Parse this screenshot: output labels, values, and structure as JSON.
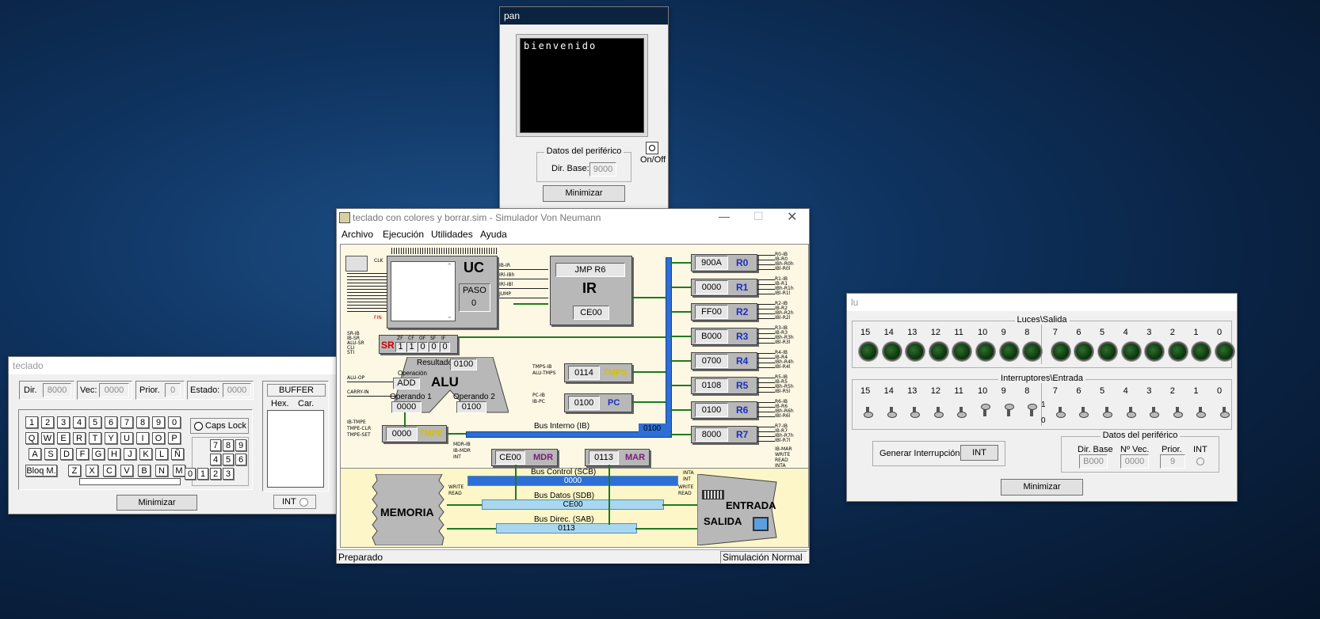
{
  "pan": {
    "title": "pan",
    "screen_text": "bienvenido",
    "group_title": "Datos del periférico",
    "dir_base_label": "Dir. Base:",
    "dir_base_value": "9000",
    "onoff_label": "On/Off",
    "minimize_label": "Minimizar"
  },
  "main": {
    "title": "teclado con colores y borrar.sim - Simulador Von Neumann",
    "menu": [
      "Archivo",
      "Ejecución",
      "Utilidades",
      "Ayuda"
    ],
    "status_left": "Preparado",
    "status_right": "Simulación Normal",
    "uc": {
      "label": "UC",
      "paso_label": "PASO",
      "paso_value": "0"
    },
    "ir": {
      "instruction": "JMP R6",
      "label": "IR",
      "value": "CE00"
    },
    "sr": {
      "label": "SR",
      "flag_names": [
        "ZF",
        "CF",
        "OF",
        "SF",
        "IF"
      ],
      "flags": [
        "1",
        "1",
        "0",
        "0",
        "0"
      ]
    },
    "alu": {
      "label": "ALU",
      "resultado_label": "Resultado",
      "resultado": "0100",
      "operacion_label": "Operación",
      "operacion": "ADD",
      "op1_label": "Operando 1",
      "op1": "0000",
      "op2_label": "Operando 2",
      "op2": "0100"
    },
    "tmps": {
      "value": "0114",
      "label": "TMPS"
    },
    "pc": {
      "value": "0100",
      "label": "PC"
    },
    "tmpe": {
      "value": "0000",
      "label": "TMPE"
    },
    "mdr": {
      "value": "CE00",
      "label": "MDR"
    },
    "mar": {
      "value": "0113",
      "label": "MAR"
    },
    "bus_interno": {
      "label": "Bus Interno (IB)",
      "value": "0100"
    },
    "registers": [
      {
        "value": "900A",
        "label": "R0"
      },
      {
        "value": "0000",
        "label": "R1"
      },
      {
        "value": "FF00",
        "label": "R2"
      },
      {
        "value": "B000",
        "label": "R3"
      },
      {
        "value": "0700",
        "label": "R4"
      },
      {
        "value": "0108",
        "label": "R5"
      },
      {
        "value": "0100",
        "label": "R6"
      },
      {
        "value": "8000",
        "label": "R7"
      }
    ],
    "reg_signals": [
      [
        "R0-IB",
        "IB-R0",
        "IBh-R0h",
        "IBl-R0l"
      ],
      [
        "R1-IB",
        "IB-R1",
        "IBh-R1h",
        "IBl-R1l"
      ],
      [
        "R2-IB",
        "IB-R2",
        "IBh-R2h",
        "IBl-R2l"
      ],
      [
        "R3-IB",
        "IB-R3",
        "IBh-R3h",
        "IBl-R3l"
      ],
      [
        "R4-IB",
        "IB-R4",
        "IBh-R4h",
        "IBl-R4l"
      ],
      [
        "R5-IB",
        "IB-R5",
        "IBh-R5h",
        "IBl-R5l"
      ],
      [
        "R6-IB",
        "IB-R6",
        "IBh-R6h",
        "IBl-R6l"
      ],
      [
        "R7-IB",
        "IB-R7",
        "IBh-R7h",
        "IBl-R7l"
      ]
    ],
    "right_signals": [
      "IB-MAR",
      "WRITE",
      "READ",
      "INTA"
    ],
    "uc_signals": [
      "IB-IR",
      "IRl-IBh",
      "IRl-IBl",
      "JUMP"
    ],
    "sr_signals": [
      "SR-IB",
      "IB-SR",
      "ALU-SR",
      "CLI",
      "STI"
    ],
    "alu_signals": [
      "ALU-OP",
      "CARRY-IN"
    ],
    "tmps_signals": [
      "TMPS-IB",
      "ALU-TMPS"
    ],
    "pc_signals": [
      "PC-IB",
      "IB-PC"
    ],
    "tmpe_signals": [
      "IB-TMPE",
      "TMPE-CLR",
      "TMPE-SET"
    ],
    "mdr_signals": [
      "MDR-IB",
      "IB-MDR",
      "INT"
    ],
    "clk_label": "CLK",
    "fin_label": "FIN",
    "memoria_label": "MEMORIA",
    "entrada_label": "ENTRADA",
    "salida_label": "SALIDA",
    "scb": {
      "label": "Bus Control (SCB)",
      "value": "0000"
    },
    "sdb": {
      "label": "Bus Datos (SDB)",
      "value": "CE00"
    },
    "sab": {
      "label": "Bus Direc. (SAB)",
      "value": "0113"
    },
    "mem_signals": [
      "WRITE",
      "READ"
    ],
    "io_signals": [
      "INTA",
      "INT",
      "WRITE",
      "READ"
    ]
  },
  "teclado": {
    "title": "teclado",
    "dir_label": "Dir.",
    "dir_value": "8000",
    "vec_label": "Vec:",
    "vec_value": "0000",
    "prior_label": "Prior.",
    "prior_value": "0",
    "estado_label": "Estado:",
    "estado_value": "0000",
    "row1": [
      "1",
      "2",
      "3",
      "4",
      "5",
      "6",
      "7",
      "8",
      "9",
      "0"
    ],
    "row2": [
      "Q",
      "W",
      "E",
      "R",
      "T",
      "Y",
      "U",
      "I",
      "O",
      "P"
    ],
    "row3": [
      "A",
      "S",
      "D",
      "F",
      "G",
      "H",
      "J",
      "K",
      "L",
      "Ñ"
    ],
    "row4": [
      "Z",
      "X",
      "C",
      "V",
      "B",
      "N",
      "M"
    ],
    "bloq_label": "Bloq M.",
    "caps_label": "Caps Lock",
    "numpad": [
      "7",
      "8",
      "9",
      "4",
      "5",
      "6",
      "0",
      "1",
      "2",
      "3"
    ],
    "buffer_label": "BUFFER",
    "hex_label": "Hex.",
    "car_label": "Car.",
    "minimize_label": "Minimizar",
    "int_label": "INT"
  },
  "lu": {
    "title": "lu",
    "luces_title": "Luces\\Salida",
    "interruptores_title": "Interruptores\\Entrada",
    "bits": [
      "15",
      "14",
      "13",
      "12",
      "11",
      "10",
      "9",
      "8",
      "7",
      "6",
      "5",
      "4",
      "3",
      "2",
      "1",
      "0"
    ],
    "switch_states": [
      0,
      0,
      0,
      0,
      0,
      1,
      1,
      1,
      0,
      0,
      0,
      0,
      0,
      0,
      0,
      0
    ],
    "sw_label_1": "1",
    "sw_label_0": "0",
    "gen_int_label": "Generar Interrupción",
    "int_button": "INT",
    "datos_title": "Datos del periférico",
    "dir_base_label": "Dir. Base",
    "dir_base_value": "B000",
    "nvec_label": "Nº Vec.",
    "nvec_value": "0000",
    "prior_label": "Prior.",
    "prior_value": "9",
    "int_label": "INT",
    "minimize_label": "Minimizar"
  }
}
